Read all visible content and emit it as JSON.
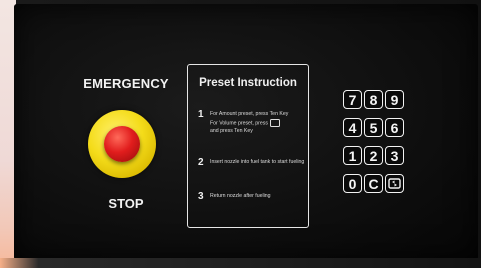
{
  "emergency": {
    "title": "EMERGENCY",
    "stop_label": "STOP",
    "button_color": "#e11d1d",
    "ring_color": "#f4dc1a"
  },
  "instructions": {
    "title": "Preset Instruction",
    "steps": [
      {
        "num": "1",
        "text_a": "For Amount preset, press Ten Key",
        "text_b": "For Volume preset, press",
        "text_c": "and press Ten Key"
      },
      {
        "num": "2",
        "text": "Insert nozzle into fuel tank to start fueling"
      },
      {
        "num": "3",
        "text": "Return nozzle after fueling"
      }
    ]
  },
  "keypad": {
    "keys": [
      "7",
      "8",
      "9",
      "4",
      "5",
      "6",
      "1",
      "2",
      "3",
      "0",
      "C"
    ],
    "special_icon": "volume-preset-icon"
  },
  "colors": {
    "panel": "#0c0c0c",
    "text": "#f2f2f2"
  }
}
